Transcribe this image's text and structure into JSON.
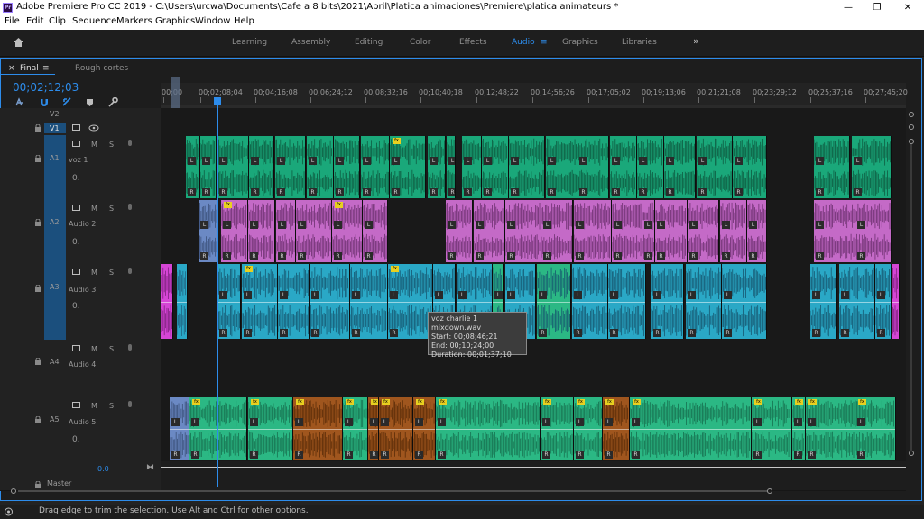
{
  "window": {
    "title": "Adobe Premiere Pro CC 2019 - C:\\Users\\urcwa\\Documents\\Cafe a 8 bits\\2021\\Abril\\Platica animaciones\\Premiere\\platica animateurs *",
    "app_icon": "Pr",
    "min": "—",
    "max": "❐",
    "close": "✕"
  },
  "menu": [
    "File",
    "Edit",
    "Clip",
    "Sequence",
    "Markers",
    "Graphics",
    "Window",
    "Help"
  ],
  "workspaces": [
    "Learning",
    "Assembly",
    "Editing",
    "Color",
    "Effects",
    "Audio",
    "Graphics",
    "Libraries"
  ],
  "workspace_active": "Audio",
  "workspace_more": "»",
  "panel": {
    "tab_close": "×",
    "tab_active": "Final",
    "tab_menu": "≡",
    "tab_other": "Rough cortes",
    "timecode": "00;02;12;03"
  },
  "ruler": [
    "00;00",
    "00;02;08;04",
    "00;04;16;08",
    "00;06;24;12",
    "00;08;32;16",
    "00;10;40;18",
    "00;12;48;22",
    "00;14;56;26",
    "00;17;05;02",
    "00;19;13;06",
    "00;21;21;08",
    "00;23;29;12",
    "00;25;37;16",
    "00;27;45;20"
  ],
  "tracks": {
    "v2": {
      "label": "V2"
    },
    "v1": {
      "label": "V1"
    },
    "a1": {
      "label": "A1",
      "name": "voz 1",
      "vol": "0."
    },
    "a2": {
      "label": "A2",
      "name": "Audio 2",
      "vol": "0."
    },
    "a3": {
      "label": "A3",
      "name": "Audio 3",
      "vol": "0."
    },
    "a4": {
      "label": "A4",
      "name": "Audio 4",
      "vol": "0."
    },
    "a5": {
      "label": "A5",
      "name": "Audio 5",
      "vol": "0."
    },
    "master": {
      "name": "Master",
      "value": "0.0"
    }
  },
  "track_buttons": {
    "m": "M",
    "s": "S"
  },
  "tooltip": {
    "name": "voz charlie 1 mixdown.wav",
    "start": "Start: 00;08;46;21",
    "end": "End: 00;10;24;00",
    "duration": "Duration: 00;01;37;10"
  },
  "status": "Drag edge to trim the selection. Use Alt and Ctrl for other options.",
  "colors": {
    "accent": "#2d8ceb",
    "a1": "#1aa87a",
    "a2": "#c46ac7",
    "a3": "#2aa8c6",
    "a5": "#2bb884",
    "brown": "#a0561e"
  }
}
